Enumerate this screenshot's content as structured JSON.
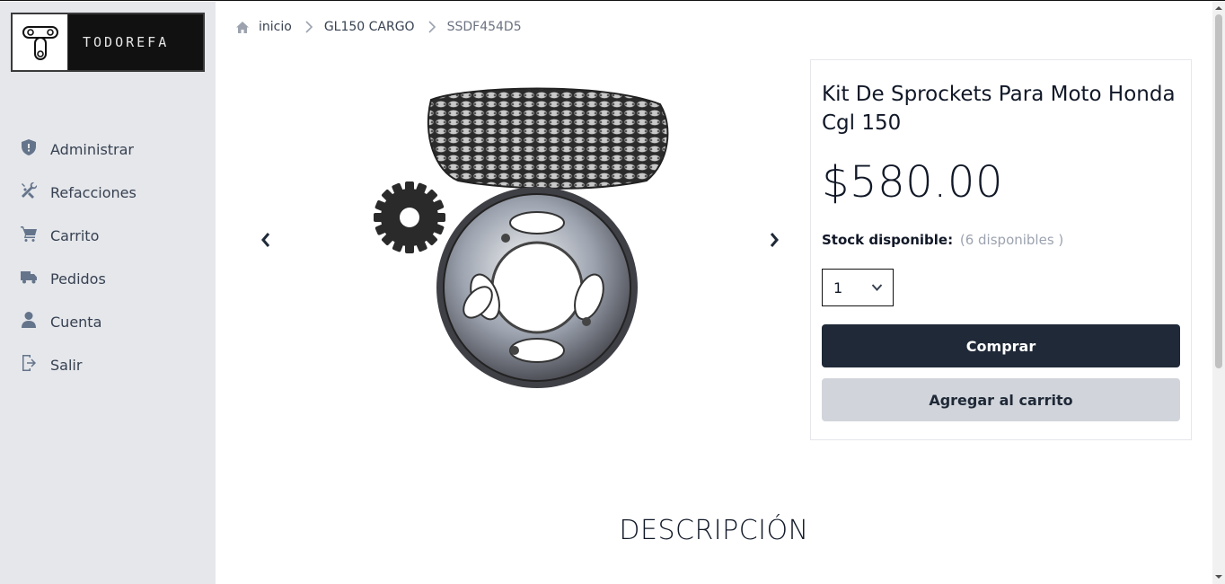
{
  "brand": {
    "name": "TODOREFA"
  },
  "sidebar": {
    "items": [
      {
        "label": "Administrar",
        "icon": "shield-icon"
      },
      {
        "label": "Refacciones",
        "icon": "tools-icon"
      },
      {
        "label": "Carrito",
        "icon": "cart-icon"
      },
      {
        "label": "Pedidos",
        "icon": "truck-icon"
      },
      {
        "label": "Cuenta",
        "icon": "user-icon"
      },
      {
        "label": "Salir",
        "icon": "logout-icon"
      }
    ]
  },
  "breadcrumb": {
    "home": "inicio",
    "category": "GL150 CARGO",
    "current": "SSDF454D5"
  },
  "product": {
    "title": "Kit De Sprockets Para Moto Honda Cgl 150",
    "price": "$580.00",
    "stock_label": "Stock disponible:",
    "stock_value": "(6 disponibles )",
    "quantity": "1",
    "buy_label": "Comprar",
    "cart_label": "Agregar al carrito"
  },
  "description": {
    "heading": "DESCRIPCIÓN"
  },
  "colors": {
    "sidebar_bg": "#e5e7eb",
    "primary_button": "#1f2937",
    "secondary_button": "#d1d5db",
    "icon_gray": "#64748b"
  }
}
